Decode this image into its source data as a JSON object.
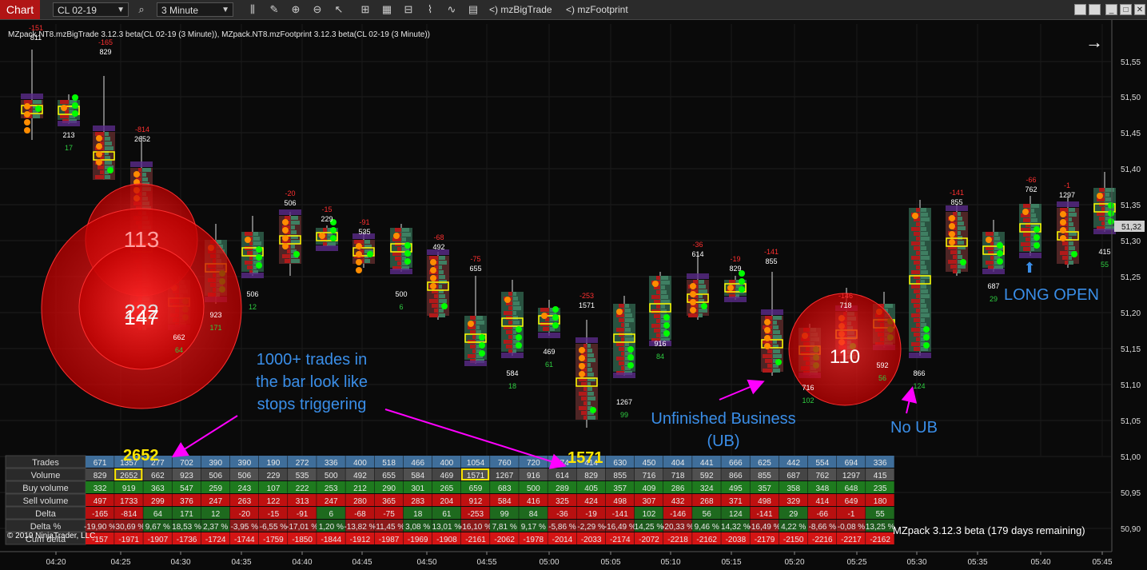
{
  "toolbar": {
    "chart_tab": "Chart",
    "instrument": "CL 02-19",
    "period": "3 Minute",
    "indicator_1": "<)  mzBigTrade",
    "indicator_2": "<)  mzFootprint"
  },
  "chart": {
    "info_line": "MZpack.NT8.mzBigTrade 3.12.3 beta(CL 02-19 (3 Minute)), MZpack.NT8.mzFootprint 3.12.3 beta(CL 02-19 (3 Minute))",
    "copyright": "© 2019 NinjaTrader, LLC",
    "watermark": "MZpack 3.12.3 beta  (179 days remaining)",
    "current_price": "51,32",
    "price_axis": [
      "51,55",
      "51,50",
      "51,45",
      "51,40",
      "51,35",
      "51,30",
      "51,25",
      "51,20",
      "51,15",
      "51,10",
      "51,05",
      "51,00",
      "50,95",
      "50,90"
    ],
    "time_axis": [
      "04:20",
      "04:25",
      "04:30",
      "04:35",
      "04:40",
      "04:45",
      "04:50",
      "04:55",
      "05:00",
      "05:05",
      "05:10",
      "05:15",
      "05:20",
      "05:25",
      "05:30",
      "05:35",
      "05:40",
      "05:45"
    ],
    "bubbles": [
      {
        "label": "113"
      },
      {
        "label": "222"
      },
      {
        "label": "147"
      },
      {
        "label": "110"
      }
    ]
  },
  "annotations": {
    "stops": [
      "1000+ trades in",
      "the bar look like",
      "stops triggering"
    ],
    "ub": [
      "Unfinished Business",
      "(UB)"
    ],
    "no_ub": "No UB",
    "long_open": "LONG OPEN",
    "callout_1": "2652",
    "callout_2": "1571"
  },
  "bars": [
    {
      "delta_top": "-151",
      "vol_top": "811",
      "vol_bottom": "",
      "delta_bottom": ""
    },
    {
      "delta_top": "",
      "vol_top": "",
      "vol_bottom": "213",
      "delta_bottom": "17"
    },
    {
      "delta_top": "-165",
      "vol_top": "829",
      "vol_bottom": "",
      "delta_bottom": ""
    },
    {
      "delta_top": "-814",
      "vol_top": "2652",
      "vol_bottom": "",
      "delta_bottom": ""
    },
    {
      "delta_top": "",
      "vol_top": "",
      "vol_bottom": "662",
      "delta_bottom": "64"
    },
    {
      "delta_top": "",
      "vol_top": "",
      "vol_bottom": "923",
      "delta_bottom": "171"
    },
    {
      "delta_top": "",
      "vol_top": "",
      "vol_bottom": "506",
      "delta_bottom": "12"
    },
    {
      "delta_top": "-20",
      "vol_top": "506",
      "vol_bottom": "",
      "delta_bottom": ""
    },
    {
      "delta_top": "-15",
      "vol_top": "229",
      "vol_bottom": "",
      "delta_bottom": ""
    },
    {
      "delta_top": "-91",
      "vol_top": "535",
      "vol_bottom": "",
      "delta_bottom": ""
    },
    {
      "delta_top": "",
      "vol_top": "",
      "vol_bottom": "500",
      "delta_bottom": "6"
    },
    {
      "delta_top": "-68",
      "vol_top": "492",
      "vol_bottom": "",
      "delta_bottom": ""
    },
    {
      "delta_top": "-75",
      "vol_top": "655",
      "vol_bottom": "",
      "delta_bottom": ""
    },
    {
      "delta_top": "",
      "vol_top": "",
      "vol_bottom": "584",
      "delta_bottom": "18"
    },
    {
      "delta_top": "",
      "vol_top": "",
      "vol_bottom": "469",
      "delta_bottom": "61"
    },
    {
      "delta_top": "-253",
      "vol_top": "1571",
      "vol_bottom": "",
      "delta_bottom": ""
    },
    {
      "delta_top": "",
      "vol_top": "",
      "vol_bottom": "1267",
      "delta_bottom": "99"
    },
    {
      "delta_top": "",
      "vol_top": "",
      "vol_bottom": "916",
      "delta_bottom": "84"
    },
    {
      "delta_top": "-36",
      "vol_top": "614",
      "vol_bottom": "",
      "delta_bottom": ""
    },
    {
      "delta_top": "-19",
      "vol_top": "829",
      "vol_bottom": "",
      "delta_bottom": ""
    },
    {
      "delta_top": "-141",
      "vol_top": "855",
      "vol_bottom": "",
      "delta_bottom": ""
    },
    {
      "delta_top": "",
      "vol_top": "",
      "vol_bottom": "716",
      "delta_bottom": "102"
    },
    {
      "delta_top": "-146",
      "vol_top": "718",
      "vol_bottom": "",
      "delta_bottom": ""
    },
    {
      "delta_top": "",
      "vol_top": "",
      "vol_bottom": "592",
      "delta_bottom": "56"
    },
    {
      "delta_top": "",
      "vol_top": "",
      "vol_bottom": "866",
      "delta_bottom": "124"
    },
    {
      "delta_top": "-141",
      "vol_top": "855",
      "vol_bottom": "",
      "delta_bottom": ""
    },
    {
      "delta_top": "",
      "vol_top": "",
      "vol_bottom": "687",
      "delta_bottom": "29"
    },
    {
      "delta_top": "-66",
      "vol_top": "762",
      "vol_bottom": "",
      "delta_bottom": ""
    },
    {
      "delta_top": "-1",
      "vol_top": "1297",
      "vol_bottom": "",
      "delta_bottom": ""
    },
    {
      "delta_top": "",
      "vol_top": "",
      "vol_bottom": "415",
      "delta_bottom": "55"
    }
  ],
  "summary": {
    "rows": [
      "Trades",
      "Volume",
      "Buy volume",
      "Sell volume",
      "Delta",
      "Delta %",
      "Cum delta"
    ],
    "columns": [
      [
        "671",
        "829",
        "332",
        "497",
        "-165",
        "-19,90 %",
        "-157"
      ],
      [
        "1357",
        "2652",
        "919",
        "1733",
        "-814",
        "-30,69 %",
        "-1971"
      ],
      [
        "277",
        "662",
        "363",
        "299",
        "64",
        "9,67 %",
        "-1907"
      ],
      [
        "702",
        "923",
        "547",
        "376",
        "171",
        "18,53 %",
        "-1736"
      ],
      [
        "390",
        "506",
        "259",
        "247",
        "12",
        "2,37 %",
        "-1724"
      ],
      [
        "390",
        "506",
        "243",
        "263",
        "-20",
        "-3,95 %",
        "-1744"
      ],
      [
        "190",
        "229",
        "107",
        "122",
        "-15",
        "-6,55 %",
        "-1759"
      ],
      [
        "272",
        "535",
        "222",
        "313",
        "-91",
        "-17,01 %",
        "-1850"
      ],
      [
        "336",
        "500",
        "253",
        "247",
        "6",
        "1,20 %",
        "-1844"
      ],
      [
        "400",
        "492",
        "212",
        "280",
        "-68",
        "-13,82 %",
        "-1912"
      ],
      [
        "518",
        "655",
        "290",
        "365",
        "-75",
        "-11,45 %",
        "-1987"
      ],
      [
        "466",
        "584",
        "301",
        "283",
        "18",
        "3,08 %",
        "-1969"
      ],
      [
        "400",
        "469",
        "265",
        "204",
        "61",
        "13,01 %",
        "-1908"
      ],
      [
        "1054",
        "1571",
        "659",
        "912",
        "-253",
        "-16,10 %",
        "-2161"
      ],
      [
        "760",
        "1267",
        "683",
        "584",
        "99",
        "7,81 %",
        "-2062"
      ],
      [
        "720",
        "916",
        "500",
        "416",
        "84",
        "9,17 %",
        "-1978"
      ],
      [
        "474",
        "614",
        "289",
        "325",
        "-36",
        "-5,86 %",
        "-2014"
      ],
      [
        "414",
        "829",
        "405",
        "424",
        "-19",
        "-2,29 %",
        "-2033"
      ],
      [
        "630",
        "855",
        "357",
        "498",
        "-141",
        "-16,49 %",
        "-2174"
      ],
      [
        "450",
        "716",
        "409",
        "307",
        "102",
        "14,25 %",
        "-2072"
      ],
      [
        "404",
        "718",
        "286",
        "432",
        "-146",
        "-20,33 %",
        "-2218"
      ],
      [
        "441",
        "592",
        "324",
        "268",
        "56",
        "9,46 %",
        "-2162"
      ],
      [
        "666",
        "866",
        "495",
        "371",
        "124",
        "14,32 %",
        "-2038"
      ],
      [
        "625",
        "855",
        "357",
        "498",
        "-141",
        "-16,49 %",
        "-2179"
      ],
      [
        "442",
        "687",
        "358",
        "329",
        "29",
        "4,22 %",
        "-2150"
      ],
      [
        "554",
        "762",
        "348",
        "414",
        "-66",
        "-8,66 %",
        "-2216"
      ],
      [
        "694",
        "1297",
        "648",
        "649",
        "-1",
        "-0,08 %",
        "-2217"
      ],
      [
        "336",
        "415",
        "235",
        "180",
        "55",
        "13,25 %",
        "-2162"
      ]
    ]
  },
  "colors": {
    "up_candle": "#3f7f62",
    "down_candle": "#b11a1a",
    "buy_row": "#1e7a1e",
    "sell_row": "#c01010",
    "trades_row": "#3f6e9a",
    "annotation": "#3a8ee8",
    "callout": "#ffe600",
    "arrow": "#ff00ff"
  }
}
